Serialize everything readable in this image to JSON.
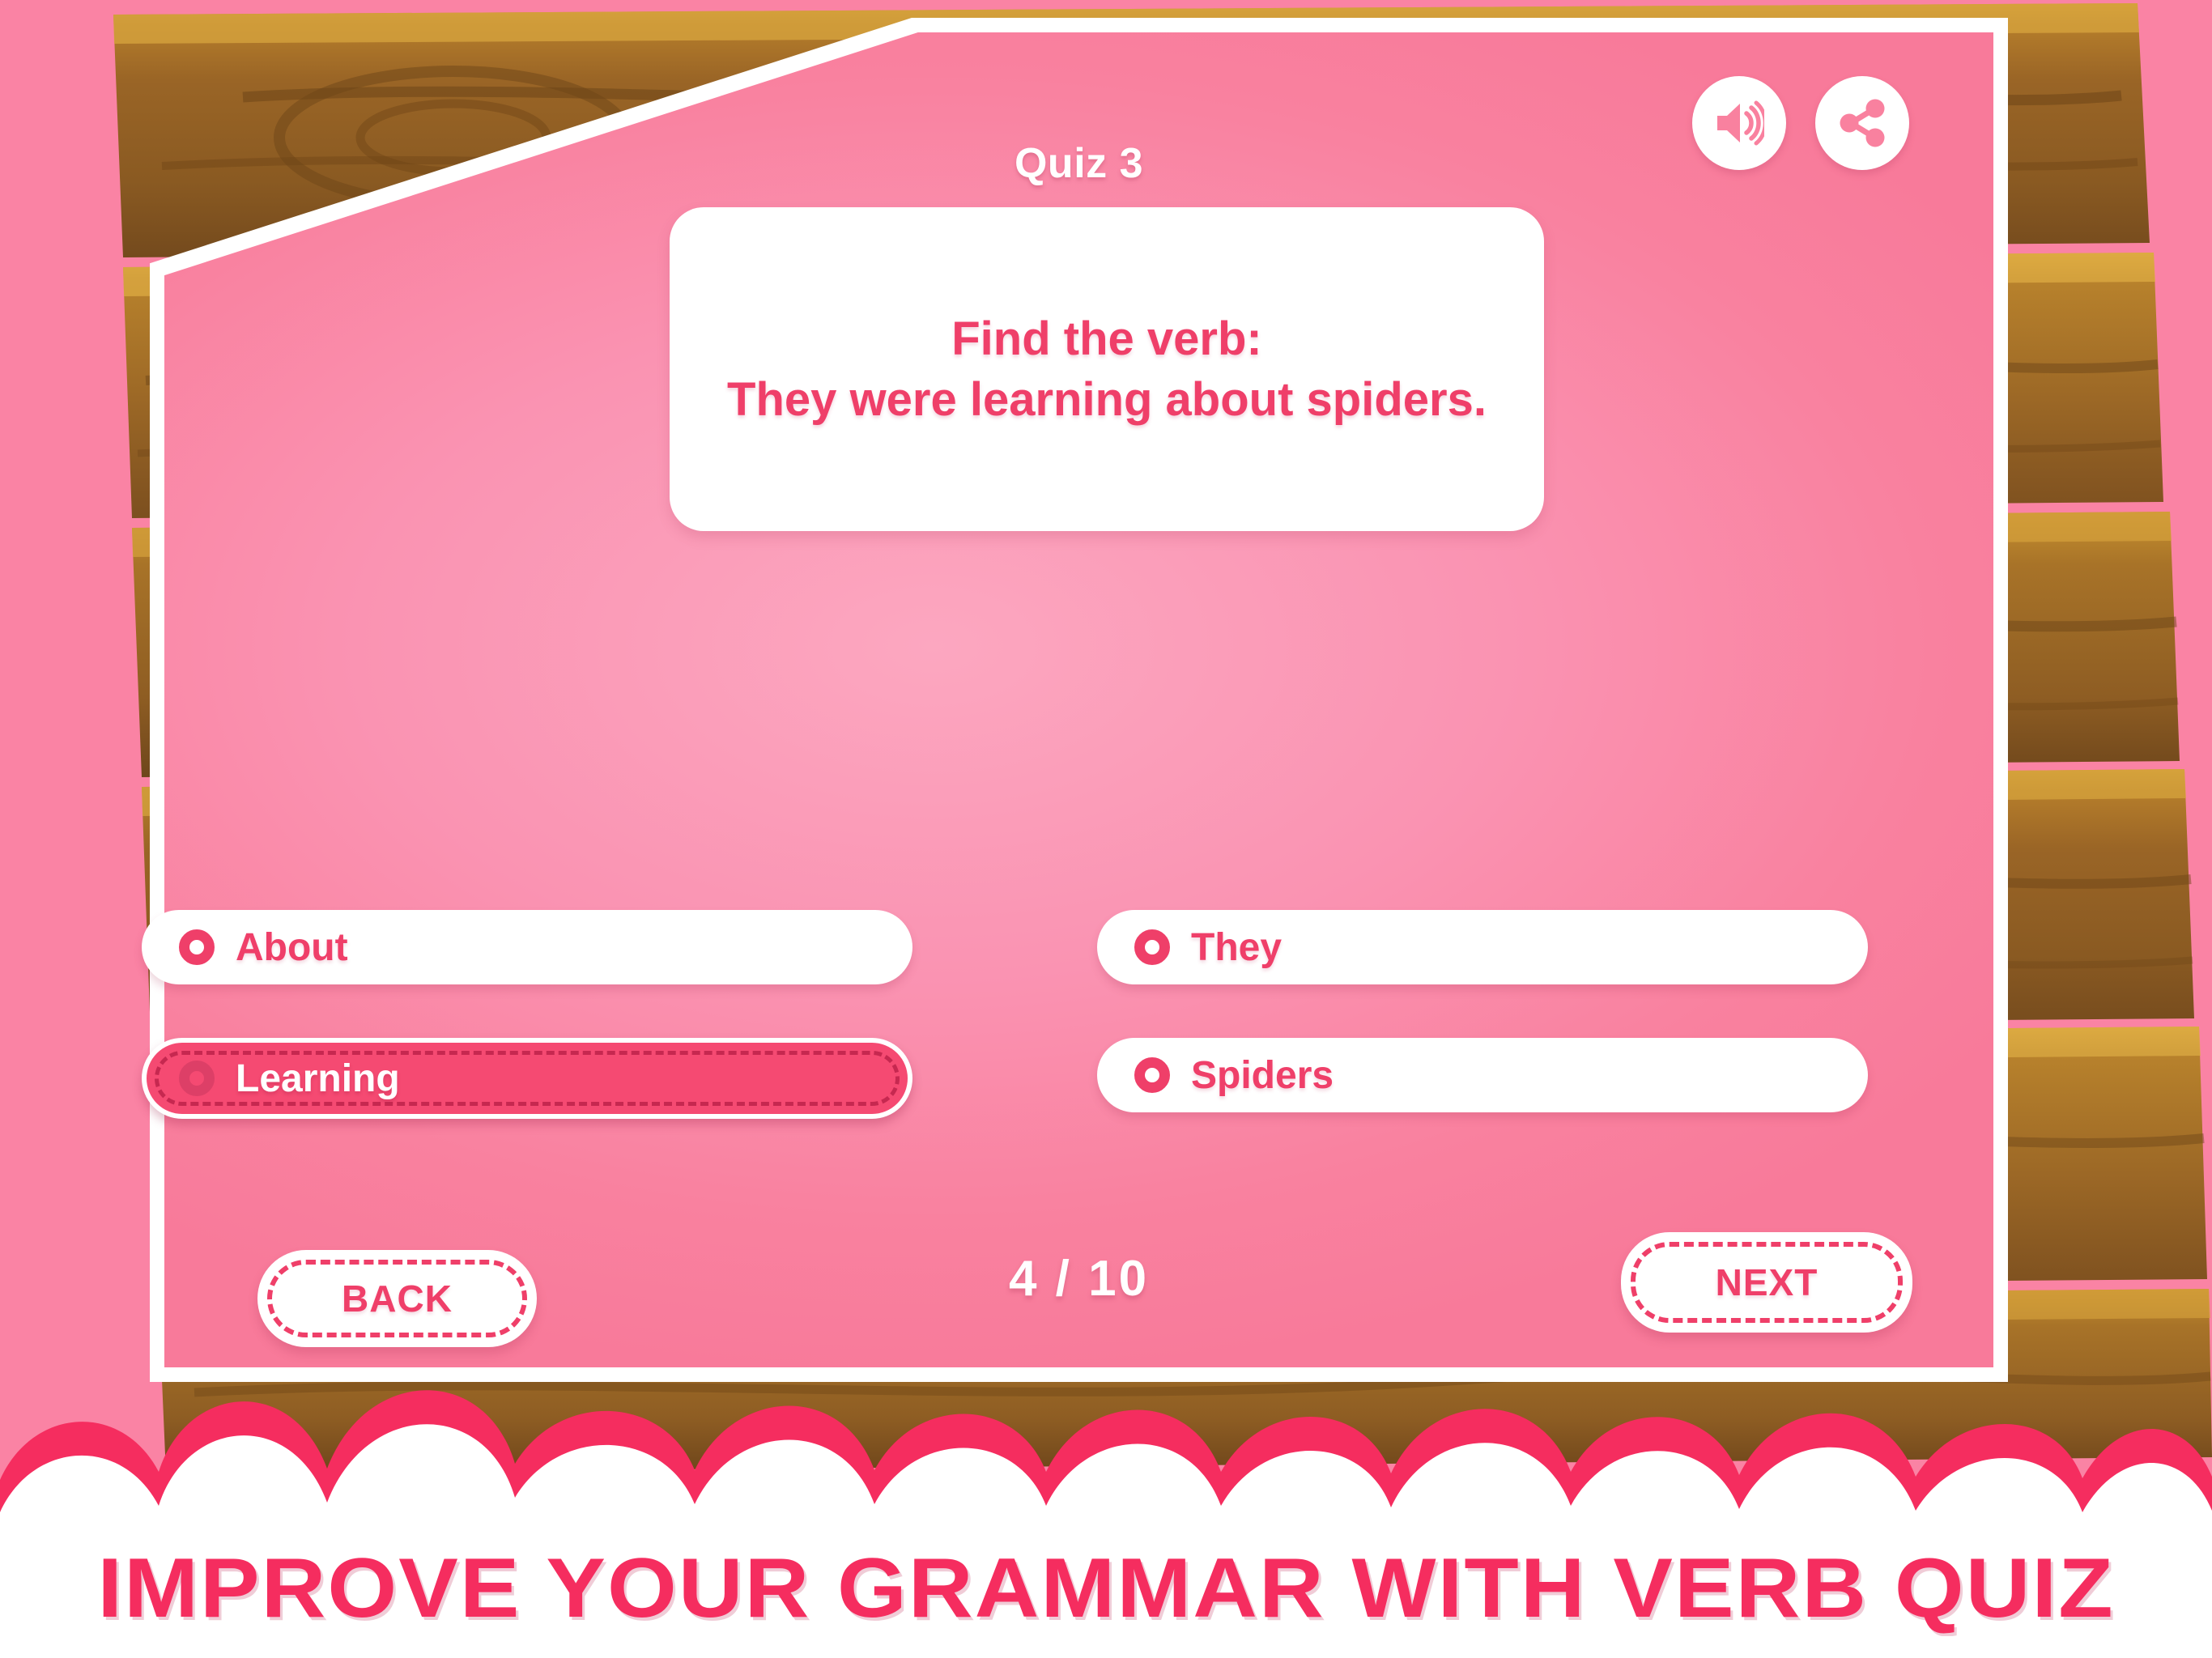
{
  "header": {
    "title": "Quiz 3",
    "sound_icon": "speaker-icon",
    "share_icon": "share-icon"
  },
  "question": {
    "text": "Find the verb:\nThey were learning about spiders."
  },
  "options": [
    {
      "label": "About",
      "selected": false,
      "radio_icon": "radio-unchecked-icon"
    },
    {
      "label": "They",
      "selected": false,
      "radio_icon": "radio-unchecked-icon"
    },
    {
      "label": "Learning",
      "selected": true,
      "radio_icon": "radio-checked-icon"
    },
    {
      "label": "Spiders",
      "selected": false,
      "radio_icon": "radio-unchecked-icon"
    }
  ],
  "footer": {
    "back_label": "BACK",
    "next_label": "NEXT",
    "progress": "4 / 10",
    "current": 4,
    "total": 10
  },
  "banner": {
    "text": "IMPROVE YOUR GRAMMAR WITH VERB QUIZ"
  },
  "colors": {
    "panel_pink": "#F9819F",
    "accent_pink": "#EF3F69",
    "selected_fill": "#F54A72",
    "banner_pink": "#F52D5F",
    "cloud_outline": "#F52D5F",
    "white": "#FFFFFF",
    "wood_dark": "#8D5C22",
    "wood_light": "#C8912F"
  }
}
